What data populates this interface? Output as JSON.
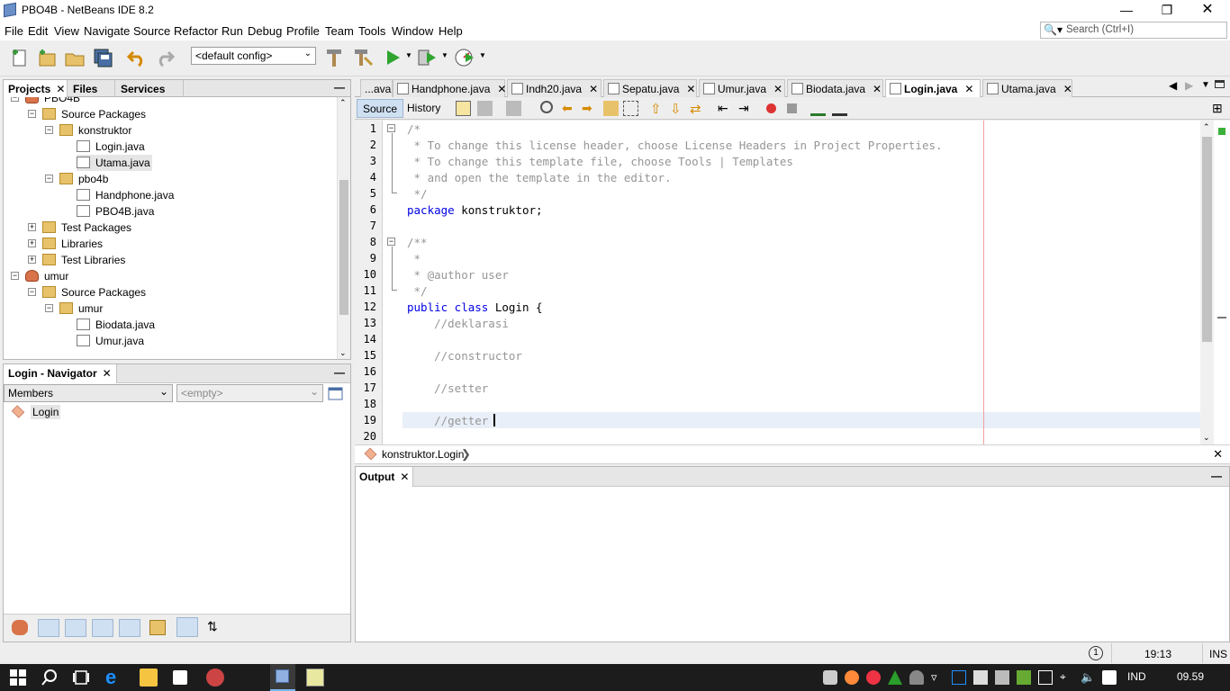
{
  "window": {
    "title": "PBO4B - NetBeans IDE 8.2"
  },
  "menu": [
    "File",
    "Edit",
    "View",
    "Navigate",
    "Source",
    "Refactor",
    "Run",
    "Debug",
    "Profile",
    "Team",
    "Tools",
    "Window",
    "Help"
  ],
  "search": {
    "placeholder": "Search (Ctrl+I)"
  },
  "toolbar": {
    "config": "<default config>"
  },
  "projects_panel": {
    "tabs": [
      "Projects",
      "Files",
      "Services"
    ],
    "tree": [
      {
        "label": "PBO4B",
        "kind": "proj",
        "indent": 0,
        "exp": "-"
      },
      {
        "label": "Source Packages",
        "kind": "pkg",
        "indent": 1,
        "exp": "-"
      },
      {
        "label": "konstruktor",
        "kind": "pkg",
        "indent": 2,
        "exp": "-"
      },
      {
        "label": "Login.java",
        "kind": "java",
        "indent": 3,
        "exp": ""
      },
      {
        "label": "Utama.java",
        "kind": "java",
        "indent": 3,
        "exp": "",
        "selected": true
      },
      {
        "label": "pbo4b",
        "kind": "pkg",
        "indent": 2,
        "exp": "-"
      },
      {
        "label": "Handphone.java",
        "kind": "java",
        "indent": 3,
        "exp": ""
      },
      {
        "label": "PBO4B.java",
        "kind": "java",
        "indent": 3,
        "exp": ""
      },
      {
        "label": "Test Packages",
        "kind": "pkg",
        "indent": 1,
        "exp": "+"
      },
      {
        "label": "Libraries",
        "kind": "lib",
        "indent": 1,
        "exp": "+"
      },
      {
        "label": "Test Libraries",
        "kind": "lib",
        "indent": 1,
        "exp": "+"
      },
      {
        "label": "umur",
        "kind": "proj",
        "indent": 0,
        "exp": "-"
      },
      {
        "label": "Source Packages",
        "kind": "pkg",
        "indent": 1,
        "exp": "-"
      },
      {
        "label": "umur",
        "kind": "pkg",
        "indent": 2,
        "exp": "-"
      },
      {
        "label": "Biodata.java",
        "kind": "java",
        "indent": 3,
        "exp": ""
      },
      {
        "label": "Umur.java",
        "kind": "java",
        "indent": 3,
        "exp": ""
      }
    ]
  },
  "navigator": {
    "title": "Login - Navigator",
    "members": "Members",
    "filter": "<empty>",
    "item": "Login"
  },
  "editor": {
    "tabs": [
      {
        "label": "...ava",
        "close": false,
        "active": false
      },
      {
        "label": "Handphone.java",
        "close": true,
        "active": false
      },
      {
        "label": "Indh20.java",
        "close": true,
        "active": false
      },
      {
        "label": "Sepatu.java",
        "close": true,
        "active": false
      },
      {
        "label": "Umur.java",
        "close": true,
        "active": false
      },
      {
        "label": "Biodata.java",
        "close": true,
        "active": false
      },
      {
        "label": "Login.java",
        "close": true,
        "active": true
      },
      {
        "label": "Utama.java",
        "close": true,
        "active": false
      }
    ],
    "source_tab": "Source",
    "history_tab": "History",
    "lines": [
      {
        "n": "1",
        "parts": [
          {
            "t": "/*",
            "c": "cm"
          }
        ]
      },
      {
        "n": "2",
        "parts": [
          {
            "t": " * To change this license header, choose License Headers in Project Properties.",
            "c": "cm"
          }
        ]
      },
      {
        "n": "3",
        "parts": [
          {
            "t": " * To change this template file, choose Tools | Templates",
            "c": "cm"
          }
        ]
      },
      {
        "n": "4",
        "parts": [
          {
            "t": " * and open the template in the editor.",
            "c": "cm"
          }
        ]
      },
      {
        "n": "5",
        "parts": [
          {
            "t": " */",
            "c": "cm"
          }
        ]
      },
      {
        "n": "6",
        "parts": [
          {
            "t": "package",
            "c": "kw"
          },
          {
            "t": " konstruktor;",
            "c": ""
          }
        ]
      },
      {
        "n": "7",
        "parts": []
      },
      {
        "n": "8",
        "parts": [
          {
            "t": "/**",
            "c": "cm"
          }
        ]
      },
      {
        "n": "9",
        "parts": [
          {
            "t": " *",
            "c": "cm"
          }
        ]
      },
      {
        "n": "10",
        "parts": [
          {
            "t": " * @author user",
            "c": "cm"
          }
        ]
      },
      {
        "n": "11",
        "parts": [
          {
            "t": " */",
            "c": "cm"
          }
        ]
      },
      {
        "n": "12",
        "parts": [
          {
            "t": "public class",
            "c": "kw"
          },
          {
            "t": " Login {",
            "c": ""
          }
        ]
      },
      {
        "n": "13",
        "parts": [
          {
            "t": "    //deklarasi",
            "c": "cm"
          }
        ]
      },
      {
        "n": "14",
        "parts": []
      },
      {
        "n": "15",
        "parts": [
          {
            "t": "    //constructor",
            "c": "cm"
          }
        ]
      },
      {
        "n": "16",
        "parts": []
      },
      {
        "n": "17",
        "parts": [
          {
            "t": "    //setter",
            "c": "cm"
          }
        ]
      },
      {
        "n": "18",
        "parts": []
      },
      {
        "n": "19",
        "parts": [
          {
            "t": "    //getter",
            "c": "cm"
          }
        ]
      },
      {
        "n": "20",
        "parts": []
      }
    ],
    "breadcrumb": "konstruktor.Login"
  },
  "output": {
    "title": "Output"
  },
  "status": {
    "position": "19:13",
    "mode": "INS",
    "notif": "1"
  },
  "taskbar": {
    "lang": "IND",
    "time": "09.59"
  },
  "colors": {
    "keyword": "#0000e6",
    "comment": "#969696",
    "accent": "#cfe0f2"
  }
}
